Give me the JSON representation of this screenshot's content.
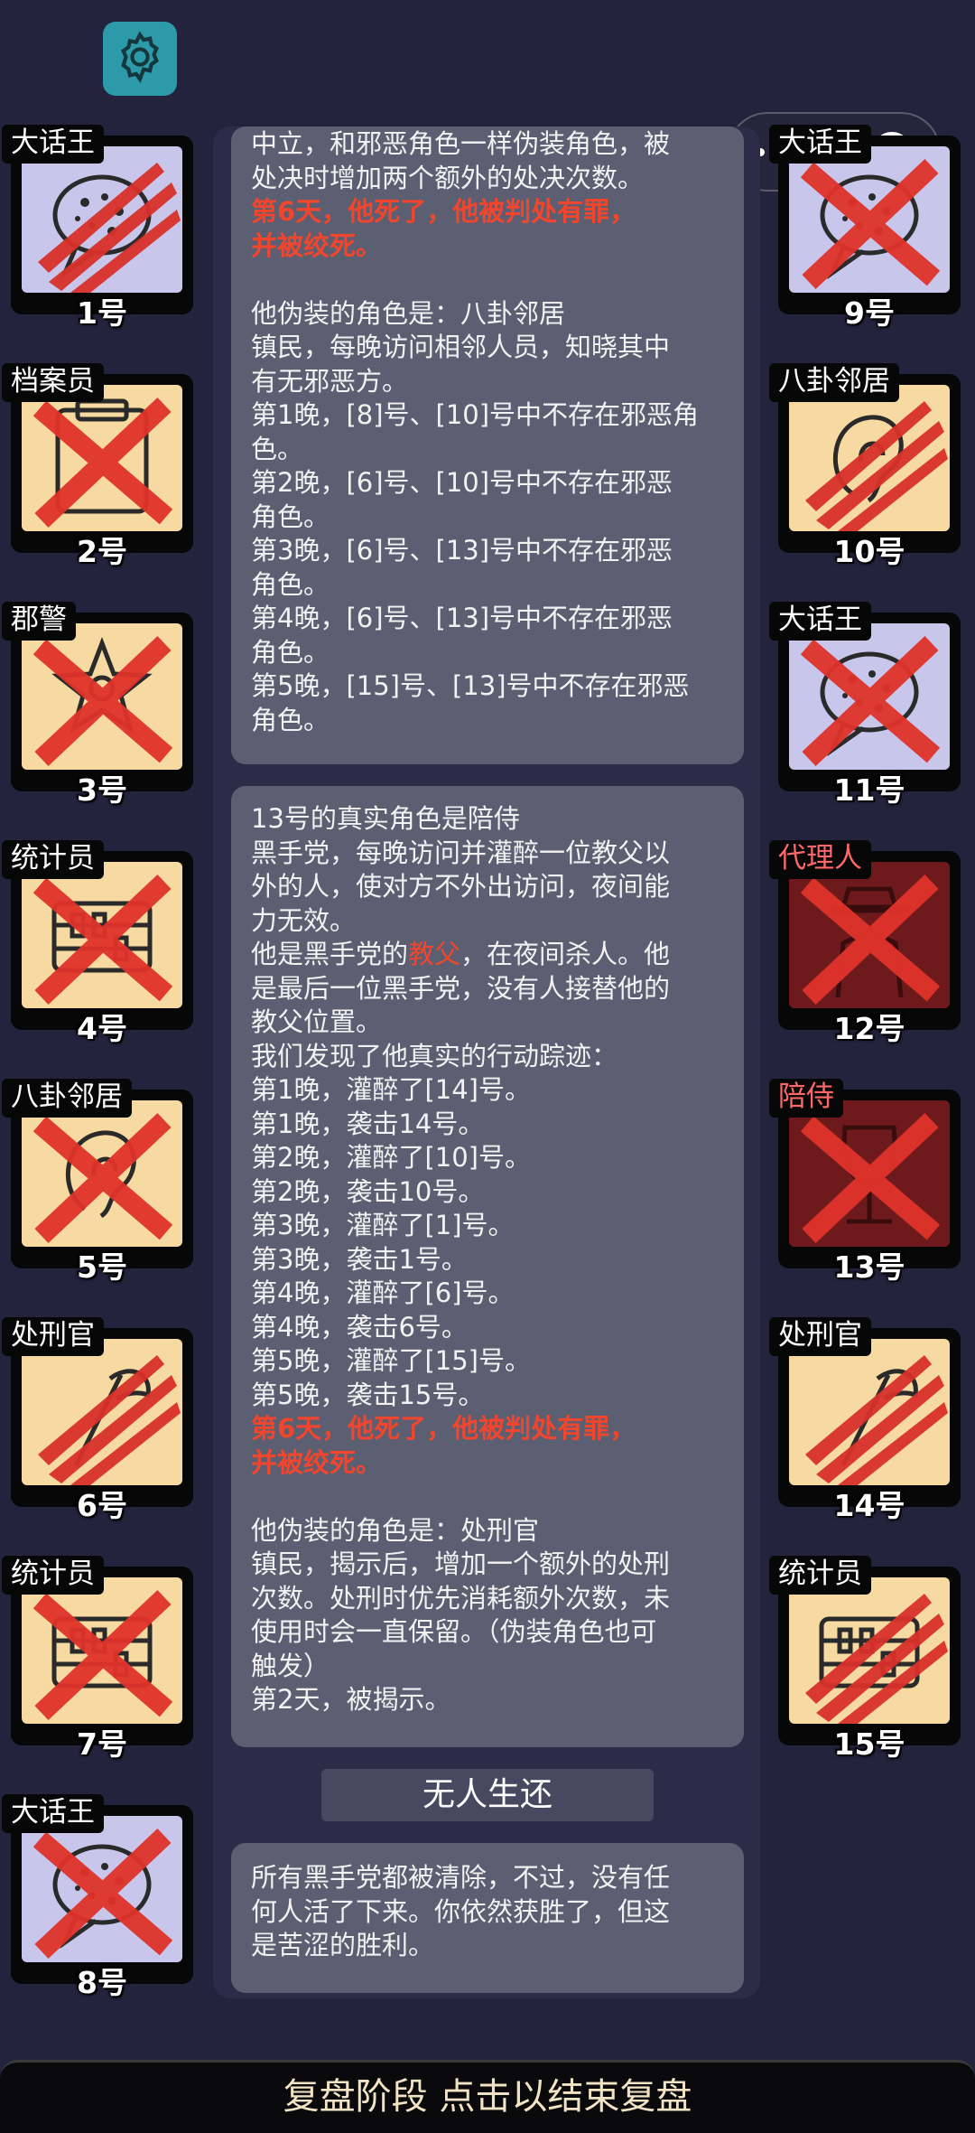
{
  "cards_left": [
    {
      "name": "大话王",
      "num": "1号",
      "bg": "blue",
      "icon": "speech-bubble",
      "mark": "claw",
      "name_color": "white"
    },
    {
      "name": "档案员",
      "num": "2号",
      "bg": "tan",
      "icon": "folder",
      "mark": "cross",
      "name_color": "white"
    },
    {
      "name": "郡警",
      "num": "3号",
      "bg": "tan",
      "icon": "badge",
      "mark": "cross",
      "name_color": "white"
    },
    {
      "name": "统计员",
      "num": "4号",
      "bg": "tan",
      "icon": "abacus",
      "mark": "cross",
      "name_color": "white"
    },
    {
      "name": "八卦邻居",
      "num": "5号",
      "bg": "tan",
      "icon": "ear",
      "mark": "cross",
      "name_color": "white"
    },
    {
      "name": "处刑官",
      "num": "6号",
      "bg": "tan",
      "icon": "axe",
      "mark": "claw",
      "name_color": "white"
    },
    {
      "name": "统计员",
      "num": "7号",
      "bg": "tan",
      "icon": "abacus",
      "mark": "cross",
      "name_color": "white"
    },
    {
      "name": "大话王",
      "num": "8号",
      "bg": "blue",
      "icon": "speech-bubble",
      "mark": "cross",
      "name_color": "white"
    }
  ],
  "cards_right": [
    {
      "name": "大话王",
      "num": "9号",
      "bg": "blue",
      "icon": "speech-bubble",
      "mark": "cross",
      "name_color": "white"
    },
    {
      "name": "八卦邻居",
      "num": "10号",
      "bg": "tan",
      "icon": "ear",
      "mark": "claw",
      "name_color": "white"
    },
    {
      "name": "大话王",
      "num": "11号",
      "bg": "blue",
      "icon": "speech-bubble",
      "mark": "cross",
      "name_color": "white"
    },
    {
      "name": "代理人",
      "num": "12号",
      "bg": "red",
      "icon": "hat-coat",
      "mark": "cross",
      "name_color": "red"
    },
    {
      "name": "陪侍",
      "num": "13号",
      "bg": "red",
      "icon": "wine-glass",
      "mark": "cross",
      "name_color": "red"
    },
    {
      "name": "处刑官",
      "num": "14号",
      "bg": "tan",
      "icon": "axe",
      "mark": "claw",
      "name_color": "white"
    },
    {
      "name": "统计员",
      "num": "15号",
      "bg": "tan",
      "icon": "abacus",
      "mark": "claw",
      "name_color": "white"
    }
  ],
  "panel1": {
    "lines": [
      {
        "t": "中立，和邪恶角色一样伪装角色，被"
      },
      {
        "t": "处决时增加两个额外的处决次数。"
      },
      {
        "t": "第6天，他死了，他被判处有罪，",
        "red": true
      },
      {
        "t": "并被绞死。",
        "red": true
      },
      {
        "t": "",
        "gap": true
      },
      {
        "t": "他伪装的角色是：八卦邻居"
      },
      {
        "t": "镇民，每晚访问相邻人员，知晓其中"
      },
      {
        "t": "有无邪恶方。"
      },
      {
        "t": "第1晚，[8]号、[10]号中不存在邪恶角"
      },
      {
        "t": "色。"
      },
      {
        "t": "第2晚，[6]号、[10]号中不存在邪恶"
      },
      {
        "t": "角色。"
      },
      {
        "t": "第3晚，[6]号、[13]号中不存在邪恶"
      },
      {
        "t": "角色。"
      },
      {
        "t": "第4晚，[6]号、[13]号中不存在邪恶"
      },
      {
        "t": "角色。"
      },
      {
        "t": "第5晚，[15]号、[13]号中不存在邪恶"
      },
      {
        "t": "角色。"
      }
    ]
  },
  "panel2": {
    "line_before_kw_a": "他是黑手党的",
    "kw": "教父",
    "line_before_kw_b": "，在夜间杀人。他",
    "lines_head": [
      {
        "t": "13号的真实角色是陪侍"
      },
      {
        "t": "黑手党，每晚访问并灌醉一位教父以"
      },
      {
        "t": "外的人，使对方不外出访问，夜间能"
      },
      {
        "t": "力无效。"
      }
    ],
    "lines_tail": [
      {
        "t": "是最后一位黑手党，没有人接替他的"
      },
      {
        "t": "教父位置。"
      },
      {
        "t": "我们发现了他真实的行动踪迹："
      },
      {
        "t": "第1晚，灌醉了[14]号。"
      },
      {
        "t": "第1晚，袭击14号。"
      },
      {
        "t": "第2晚，灌醉了[10]号。"
      },
      {
        "t": "第2晚，袭击10号。"
      },
      {
        "t": "第3晚，灌醉了[1]号。"
      },
      {
        "t": "第3晚，袭击1号。"
      },
      {
        "t": "第4晚，灌醉了[6]号。"
      },
      {
        "t": "第4晚，袭击6号。"
      },
      {
        "t": "第5晚，灌醉了[15]号。"
      },
      {
        "t": "第5晚，袭击15号。"
      },
      {
        "t": "第6天，他死了，他被判处有罪，",
        "red": true
      },
      {
        "t": "并被绞死。",
        "red": true
      },
      {
        "t": "",
        "gap": true
      },
      {
        "t": "他伪装的角色是：处刑官"
      },
      {
        "t": "镇民，揭示后，增加一个额外的处刑"
      },
      {
        "t": "次数。处刑时优先消耗额外次数，未"
      },
      {
        "t": "使用时会一直保留。（伪装角色也可"
      },
      {
        "t": "触发）"
      },
      {
        "t": "第2天，被揭示。"
      }
    ]
  },
  "banner": "无人生还",
  "panel3": {
    "lines": [
      {
        "t": "所有黑手党都被清除，不过，没有任"
      },
      {
        "t": "何人活了下来。你依然获胜了，但这"
      },
      {
        "t": "是苦涩的胜利。"
      }
    ]
  },
  "bottom_button": "复盘阶段 点击以结束复盘",
  "colors": {
    "accent_red": "#f0462e",
    "card_blue": "#c8c6ea",
    "card_tan": "#f7d9a2",
    "card_red": "#6e1a1c",
    "settings_teal": "#2c9aa8"
  }
}
